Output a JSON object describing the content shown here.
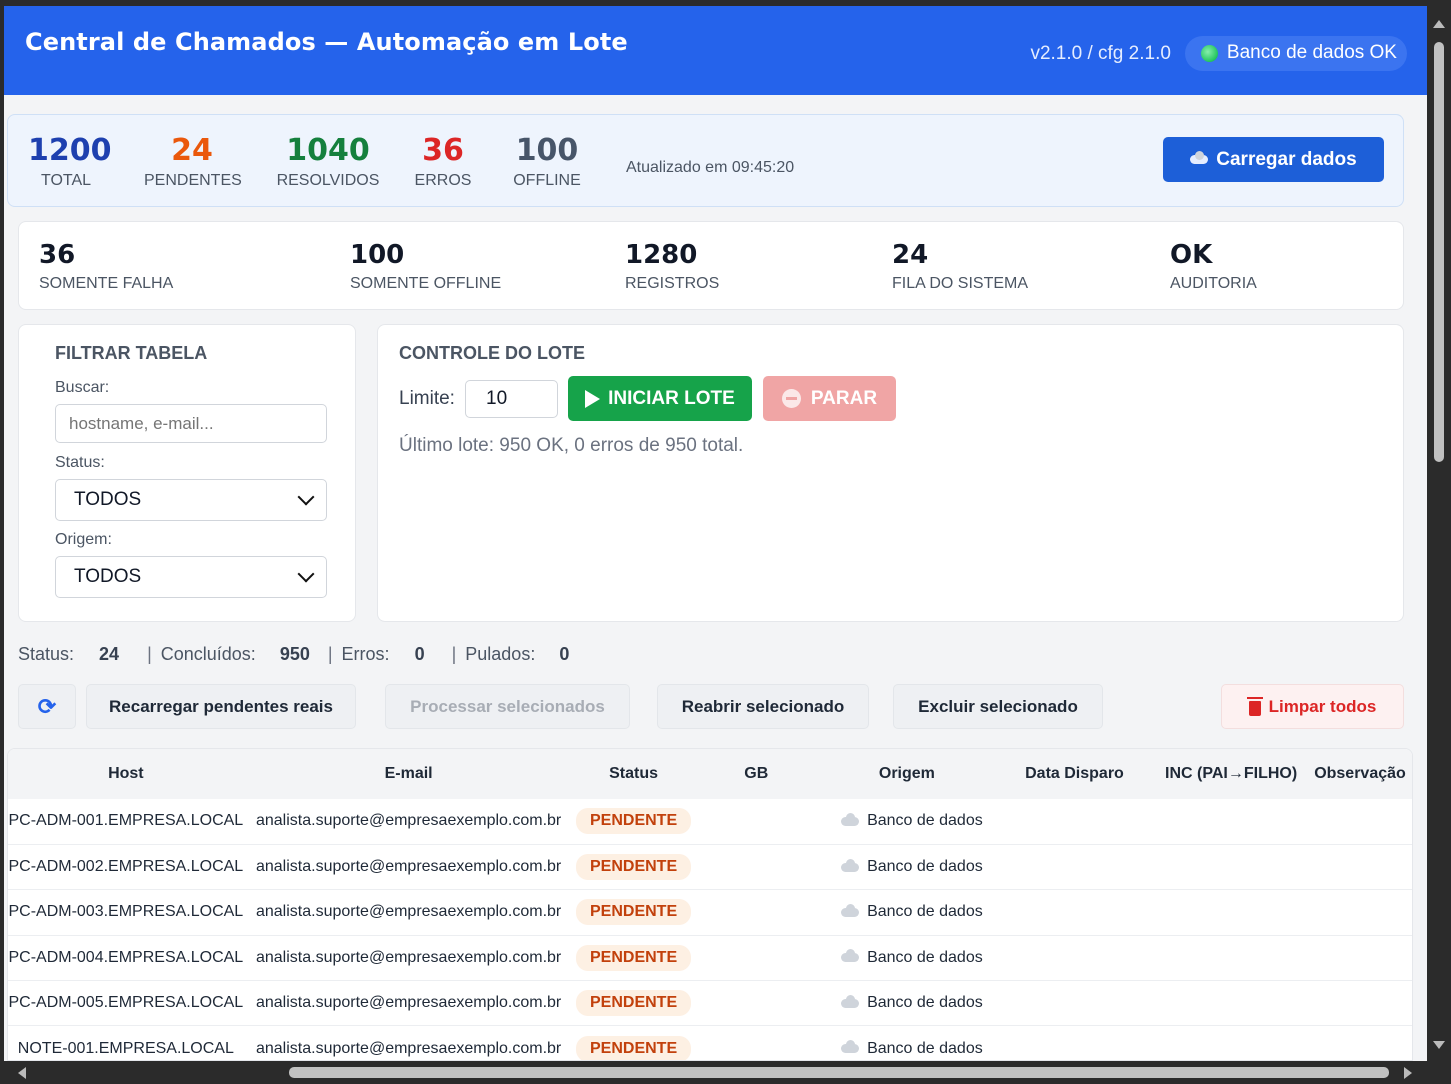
{
  "header": {
    "title": "Central de Chamados — Automação em Lote",
    "version": "v2.1.0 / cfg 2.1.0",
    "db_status": "Banco de dados OK"
  },
  "stats": {
    "items": [
      {
        "value": "1200",
        "label": "TOTAL",
        "color": "#1e40af"
      },
      {
        "value": "24",
        "label": "PENDENTES",
        "color": "#ea580c"
      },
      {
        "value": "1040",
        "label": "RESOLVIDOS",
        "color": "#15803d"
      },
      {
        "value": "36",
        "label": "ERROS",
        "color": "#dc2626"
      },
      {
        "value": "100",
        "label": "OFFLINE",
        "color": "#475569"
      }
    ],
    "updated": "Atualizado em 09:45:20",
    "load_button": "Carregar dados",
    "load_icon": "cloud-icon"
  },
  "metrics": [
    {
      "value": "36",
      "label": "SOMENTE FALHA"
    },
    {
      "value": "100",
      "label": "SOMENTE OFFLINE"
    },
    {
      "value": "1280",
      "label": "REGISTROS"
    },
    {
      "value": "24",
      "label": "FILA DO SISTEMA"
    },
    {
      "value": "OK",
      "label": "AUDITORIA"
    }
  ],
  "filter": {
    "title": "FILTRAR TABELA",
    "search_label": "Buscar:",
    "search_placeholder": "hostname, e-mail...",
    "search_value": "",
    "status_label": "Status:",
    "status_value": "TODOS",
    "origem_label": "Origem:",
    "origem_value": "TODOS"
  },
  "lote": {
    "title": "CONTROLE DO LOTE",
    "limit_label": "Limite:",
    "limit_value": "10",
    "start_button": "INICIAR LOTE",
    "stop_button": "PARAR",
    "last_result": "Último lote: 950 OK, 0 erros de 950 total."
  },
  "statusbar": {
    "status_label": "Status:",
    "status_value": "24",
    "done_label": "Concluídos:",
    "done_value": "950",
    "errors_label": "Erros:",
    "errors_value": "0",
    "skipped_label": "Pulados:",
    "skipped_value": "0",
    "separator": "|"
  },
  "actions": {
    "refresh_icon": "refresh-icon",
    "reload": "Recarregar pendentes reais",
    "process": "Processar selecionados",
    "reopen": "Reabrir selecionado",
    "delete": "Excluir selecionado",
    "clear_all": "Limpar todos"
  },
  "table": {
    "columns": [
      "Host",
      "E-mail",
      "Status",
      "GB",
      "Origem",
      "Data Disparo",
      "INC (PAI→FILHO)",
      "Observação"
    ],
    "rows": [
      {
        "host": "PC-ADM-001.EMPRESA.LOCAL",
        "email": "analista.suporte@empresaexemplo.com.br",
        "status": "PENDENTE",
        "gb": "",
        "origem": "Banco de dados",
        "data": "",
        "inc": "",
        "obs": ""
      },
      {
        "host": "PC-ADM-002.EMPRESA.LOCAL",
        "email": "analista.suporte@empresaexemplo.com.br",
        "status": "PENDENTE",
        "gb": "",
        "origem": "Banco de dados",
        "data": "",
        "inc": "",
        "obs": ""
      },
      {
        "host": "PC-ADM-003.EMPRESA.LOCAL",
        "email": "analista.suporte@empresaexemplo.com.br",
        "status": "PENDENTE",
        "gb": "",
        "origem": "Banco de dados",
        "data": "",
        "inc": "",
        "obs": ""
      },
      {
        "host": "PC-ADM-004.EMPRESA.LOCAL",
        "email": "analista.suporte@empresaexemplo.com.br",
        "status": "PENDENTE",
        "gb": "",
        "origem": "Banco de dados",
        "data": "",
        "inc": "",
        "obs": ""
      },
      {
        "host": "PC-ADM-005.EMPRESA.LOCAL",
        "email": "analista.suporte@empresaexemplo.com.br",
        "status": "PENDENTE",
        "gb": "",
        "origem": "Banco de dados",
        "data": "",
        "inc": "",
        "obs": ""
      },
      {
        "host": "NOTE-001.EMPRESA.LOCAL",
        "email": "analista.suporte@empresaexemplo.com.br",
        "status": "PENDENTE",
        "gb": "",
        "origem": "Banco de dados",
        "data": "",
        "inc": "",
        "obs": ""
      }
    ]
  }
}
